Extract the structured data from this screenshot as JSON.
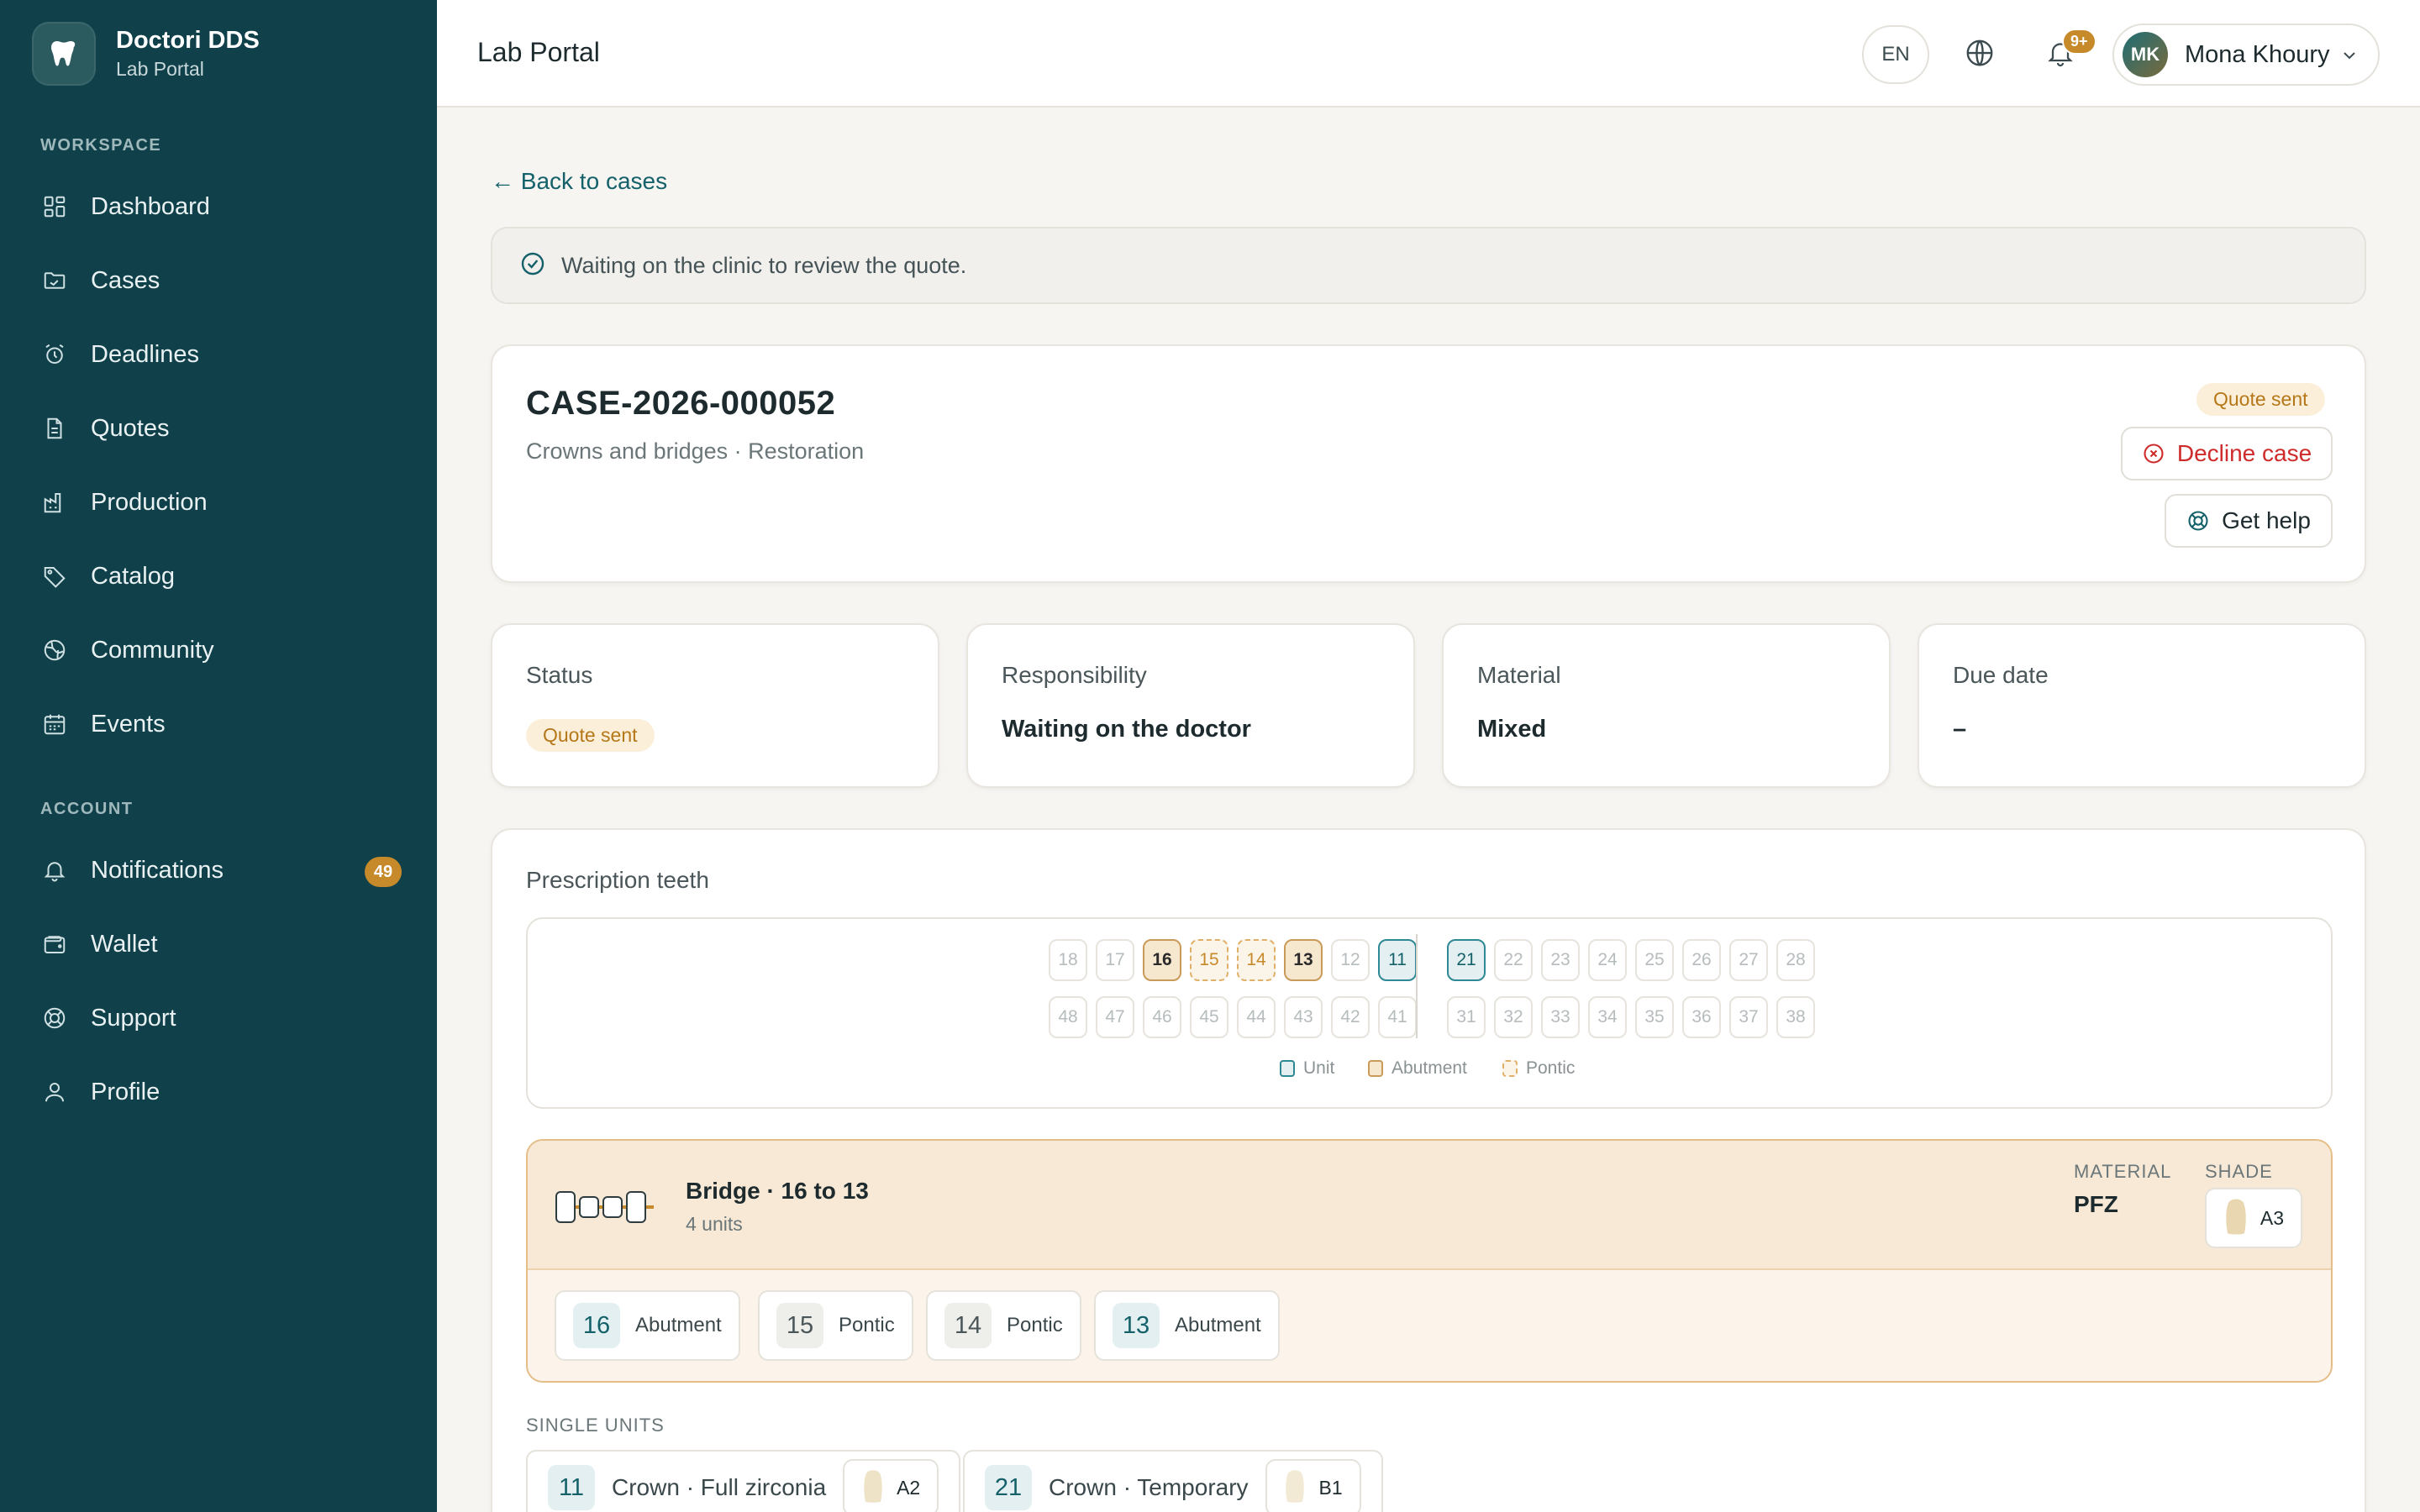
{
  "brand": {
    "name": "Doctori DDS",
    "subtitle": "Lab Portal"
  },
  "sidebar": {
    "workspace_label": "WORKSPACE",
    "account_label": "ACCOUNT",
    "workspace_items": [
      {
        "label": "Dashboard",
        "icon": "grid-icon"
      },
      {
        "label": "Cases",
        "icon": "folder-icon"
      },
      {
        "label": "Deadlines",
        "icon": "alarm-clock-icon"
      },
      {
        "label": "Quotes",
        "icon": "document-icon"
      },
      {
        "label": "Production",
        "icon": "factory-icon"
      },
      {
        "label": "Catalog",
        "icon": "tag-icon"
      },
      {
        "label": "Community",
        "icon": "globe-icon"
      },
      {
        "label": "Events",
        "icon": "calendar-icon"
      }
    ],
    "account_items": [
      {
        "label": "Notifications",
        "icon": "bell-icon",
        "badge": "49"
      },
      {
        "label": "Wallet",
        "icon": "wallet-icon"
      },
      {
        "label": "Support",
        "icon": "lifebuoy-icon"
      },
      {
        "label": "Profile",
        "icon": "user-icon"
      }
    ]
  },
  "header": {
    "title": "Lab Portal",
    "lang": "EN",
    "notif_badge": "9+",
    "user": {
      "initials": "MK",
      "name": "Mona Khoury"
    }
  },
  "main": {
    "back_link": "← Back to cases",
    "banner": "Waiting on the clinic to review the quote.",
    "case": {
      "id": "CASE-2026-000052",
      "subtitle": "Crowns and bridges · Restoration",
      "status_pill": "Quote sent",
      "decline_label": "Decline case",
      "help_label": "Get help"
    },
    "stats": [
      {
        "label": "Status",
        "value": "Quote sent",
        "type": "pill"
      },
      {
        "label": "Responsibility",
        "value": "Waiting on the doctor"
      },
      {
        "label": "Material",
        "value": "Mixed"
      },
      {
        "label": "Due date",
        "value": "–"
      }
    ],
    "prescription": {
      "title": "Prescription teeth",
      "upper_right": [
        {
          "n": "18",
          "state": "none"
        },
        {
          "n": "17",
          "state": "none"
        },
        {
          "n": "16",
          "state": "abutment"
        },
        {
          "n": "15",
          "state": "pontic"
        },
        {
          "n": "14",
          "state": "pontic"
        },
        {
          "n": "13",
          "state": "abutment"
        },
        {
          "n": "12",
          "state": "none"
        },
        {
          "n": "11",
          "state": "unit"
        }
      ],
      "upper_left": [
        {
          "n": "21",
          "state": "unit"
        },
        {
          "n": "22",
          "state": "none"
        },
        {
          "n": "23",
          "state": "none"
        },
        {
          "n": "24",
          "state": "none"
        },
        {
          "n": "25",
          "state": "none"
        },
        {
          "n": "26",
          "state": "none"
        },
        {
          "n": "27",
          "state": "none"
        },
        {
          "n": "28",
          "state": "none"
        }
      ],
      "lower_right": [
        "48",
        "47",
        "46",
        "45",
        "44",
        "43",
        "42",
        "41"
      ],
      "lower_left": [
        "31",
        "32",
        "33",
        "34",
        "35",
        "36",
        "37",
        "38"
      ],
      "legend": {
        "unit": "Unit",
        "abutment": "Abutment",
        "pontic": "Pontic"
      },
      "bridge": {
        "title": "Bridge · 16 to 13",
        "units": "4 units",
        "material_label": "MATERIAL",
        "material": "PFZ",
        "shade_label": "SHADE",
        "shade": "A3",
        "teeth": [
          {
            "n": "16",
            "role": "Abutment"
          },
          {
            "n": "15",
            "role": "Pontic"
          },
          {
            "n": "14",
            "role": "Pontic"
          },
          {
            "n": "13",
            "role": "Abutment"
          }
        ]
      },
      "single_units_label": "SINGLE UNITS",
      "single_units": [
        {
          "n": "11",
          "label": "Crown · Full zirconia",
          "shade": "A2"
        },
        {
          "n": "21",
          "label": "Crown · Temporary",
          "shade": "B1"
        }
      ]
    }
  },
  "colors": {
    "sidebar": "#10414b",
    "accent": "#15616a",
    "warning": "#c78a2a",
    "danger": "#cf2b2b"
  }
}
